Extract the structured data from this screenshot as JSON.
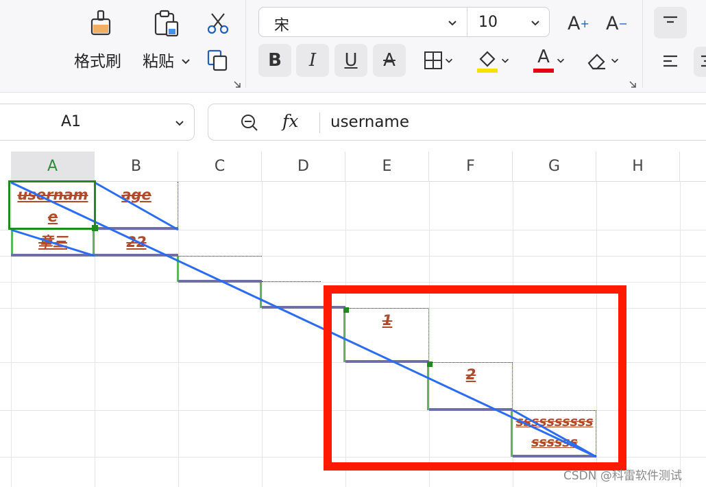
{
  "ribbon": {
    "format_painter_label": "格式刷",
    "paste_label": "粘贴",
    "font_name": "宋",
    "font_size": "10",
    "bold_label": "B",
    "italic_label": "I",
    "underline_label": "U",
    "strike_label": "A",
    "increase_font_label": "A",
    "decrease_font_label": "A",
    "font_color_label": "A",
    "fill_color": "#f2e400",
    "font_color": "#e60012"
  },
  "formula_bar": {
    "cell_ref": "A1",
    "fx_label": "fx",
    "formula_value": "username"
  },
  "columns": [
    "A",
    "B",
    "C",
    "D",
    "E",
    "F",
    "G",
    "H"
  ],
  "cells": {
    "a1": "usernam e",
    "b1": "age",
    "a2": "章三",
    "b2": "22",
    "e4": "1",
    "f5": "2",
    "g6": "ssssssssssssssss"
  },
  "active_cell": "A1",
  "accent_colors": {
    "selection": "#1f8a1f",
    "diagonal": "#2a6df4",
    "highlight_box": "#ff1a00"
  },
  "watermark": "CSDN @科雷软件测试"
}
